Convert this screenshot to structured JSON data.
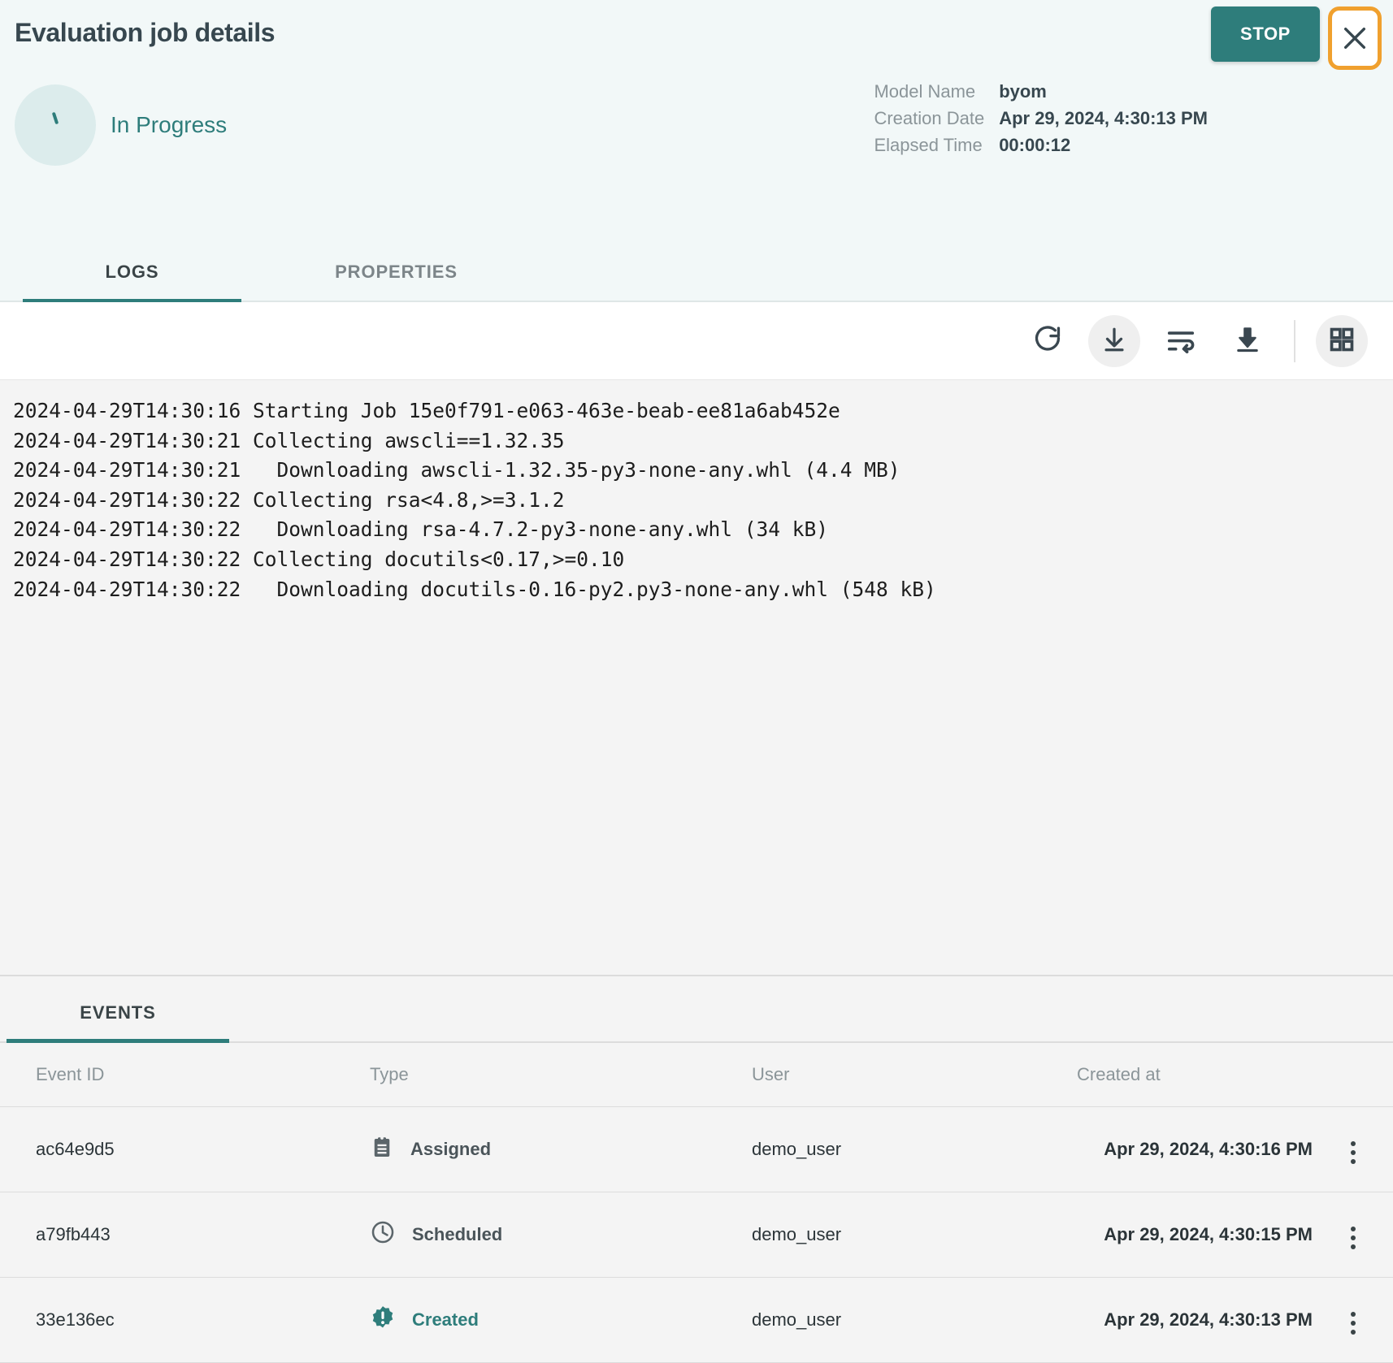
{
  "header": {
    "title": "Evaluation job details",
    "stop_label": "STOP",
    "close_icon": "close-icon",
    "status": "In Progress",
    "meta": [
      {
        "label": "Model Name",
        "value": "byom"
      },
      {
        "label": "Creation Date",
        "value": "Apr 29, 2024, 4:30:13 PM"
      },
      {
        "label": "Elapsed Time",
        "value": "00:00:12"
      }
    ],
    "tabs": [
      {
        "label": "LOGS",
        "active": true
      },
      {
        "label": "PROPERTIES",
        "active": false
      }
    ]
  },
  "toolbar": {
    "buttons": [
      {
        "name": "refresh-icon",
        "title": "Refresh"
      },
      {
        "name": "scroll-to-bottom-icon",
        "title": "Scroll to bottom"
      },
      {
        "name": "wrap-text-icon",
        "title": "Wrap text"
      },
      {
        "name": "download-icon",
        "title": "Download"
      },
      {
        "name": "grid-view-icon",
        "title": "Grid view"
      }
    ]
  },
  "logs": {
    "lines": [
      "2024-04-29T14:30:16 Starting Job 15e0f791-e063-463e-beab-ee81a6ab452e",
      "2024-04-29T14:30:21 Collecting awscli==1.32.35",
      "2024-04-29T14:30:21   Downloading awscli-1.32.35-py3-none-any.whl (4.4 MB)",
      "2024-04-29T14:30:22 Collecting rsa<4.8,>=3.1.2",
      "2024-04-29T14:30:22   Downloading rsa-4.7.2-py3-none-any.whl (34 kB)",
      "2024-04-29T14:30:22 Collecting docutils<0.17,>=0.10",
      "2024-04-29T14:30:22   Downloading docutils-0.16-py2.py3-none-any.whl (548 kB)"
    ]
  },
  "events": {
    "tab_label": "EVENTS",
    "columns": [
      "Event ID",
      "Type",
      "User",
      "Created at"
    ],
    "rows": [
      {
        "id": "ac64e9d5",
        "type": "Assigned",
        "type_icon": "clipboard-icon",
        "user": "demo_user",
        "created_at": "Apr 29, 2024, 4:30:16 PM"
      },
      {
        "id": "a79fb443",
        "type": "Scheduled",
        "type_icon": "clock-icon",
        "user": "demo_user",
        "created_at": "Apr 29, 2024, 4:30:15 PM"
      },
      {
        "id": "33e136ec",
        "type": "Created",
        "type_icon": "badge-exclamation-icon",
        "user": "demo_user",
        "created_at": "Apr 29, 2024, 4:30:13 PM"
      }
    ]
  },
  "colors": {
    "accent": "#2e7d7b",
    "highlight": "#f0a02e",
    "header_bg": "#f2f8f8",
    "log_bg": "#f4f4f4",
    "text_dark": "#37474f",
    "text_muted": "#8b9599"
  }
}
